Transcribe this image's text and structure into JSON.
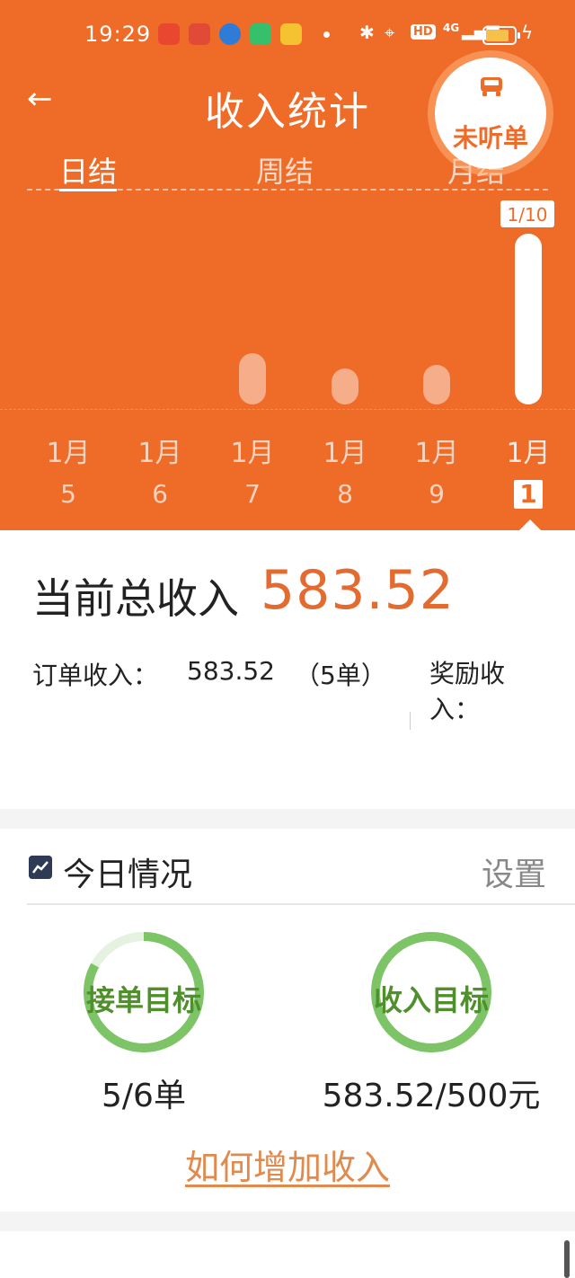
{
  "status_bar": {
    "time": "19:29",
    "hd": "HD",
    "network": "4G"
  },
  "header": {
    "title": "收入统计",
    "back_icon": "arrow-left-icon"
  },
  "floating_button": {
    "label": "未听单",
    "icon": "car-icon"
  },
  "tabs": [
    {
      "label": "日结",
      "active": true
    },
    {
      "label": "周结",
      "active": false
    },
    {
      "label": "月结",
      "active": false
    }
  ],
  "chart_data": {
    "type": "bar",
    "categories": [
      "1月5",
      "1月6",
      "1月7",
      "1月8",
      "1月9",
      "1月10"
    ],
    "values": [
      0,
      0,
      175,
      65,
      135,
      583.52
    ],
    "selected_index": 5,
    "selected_tooltip": "1/10",
    "x_month": [
      "1月",
      "1月",
      "1月",
      "1月",
      "1月",
      "1月"
    ],
    "x_day": [
      "5",
      "6",
      "7",
      "8",
      "9",
      "1"
    ]
  },
  "income": {
    "total_label": "当前总收入",
    "total_value": "583.52",
    "order_label": "订单收入：",
    "order_value": "583.52",
    "order_count": "（5单）",
    "bonus_label": "奖励收入："
  },
  "today": {
    "title": "今日情况",
    "settings_label": "设置",
    "goals": [
      {
        "label": "接单目标",
        "value": "5/6单",
        "progress": 0.83
      },
      {
        "label": "收入目标",
        "value": "583.52/500元",
        "progress": 1.0
      }
    ],
    "how_link": "如何增加收入"
  },
  "colors": {
    "brand": "#ef6b28",
    "accent_text": "#e46b30",
    "ring": "#7cc466",
    "ring_track": "#e6f2e0"
  }
}
